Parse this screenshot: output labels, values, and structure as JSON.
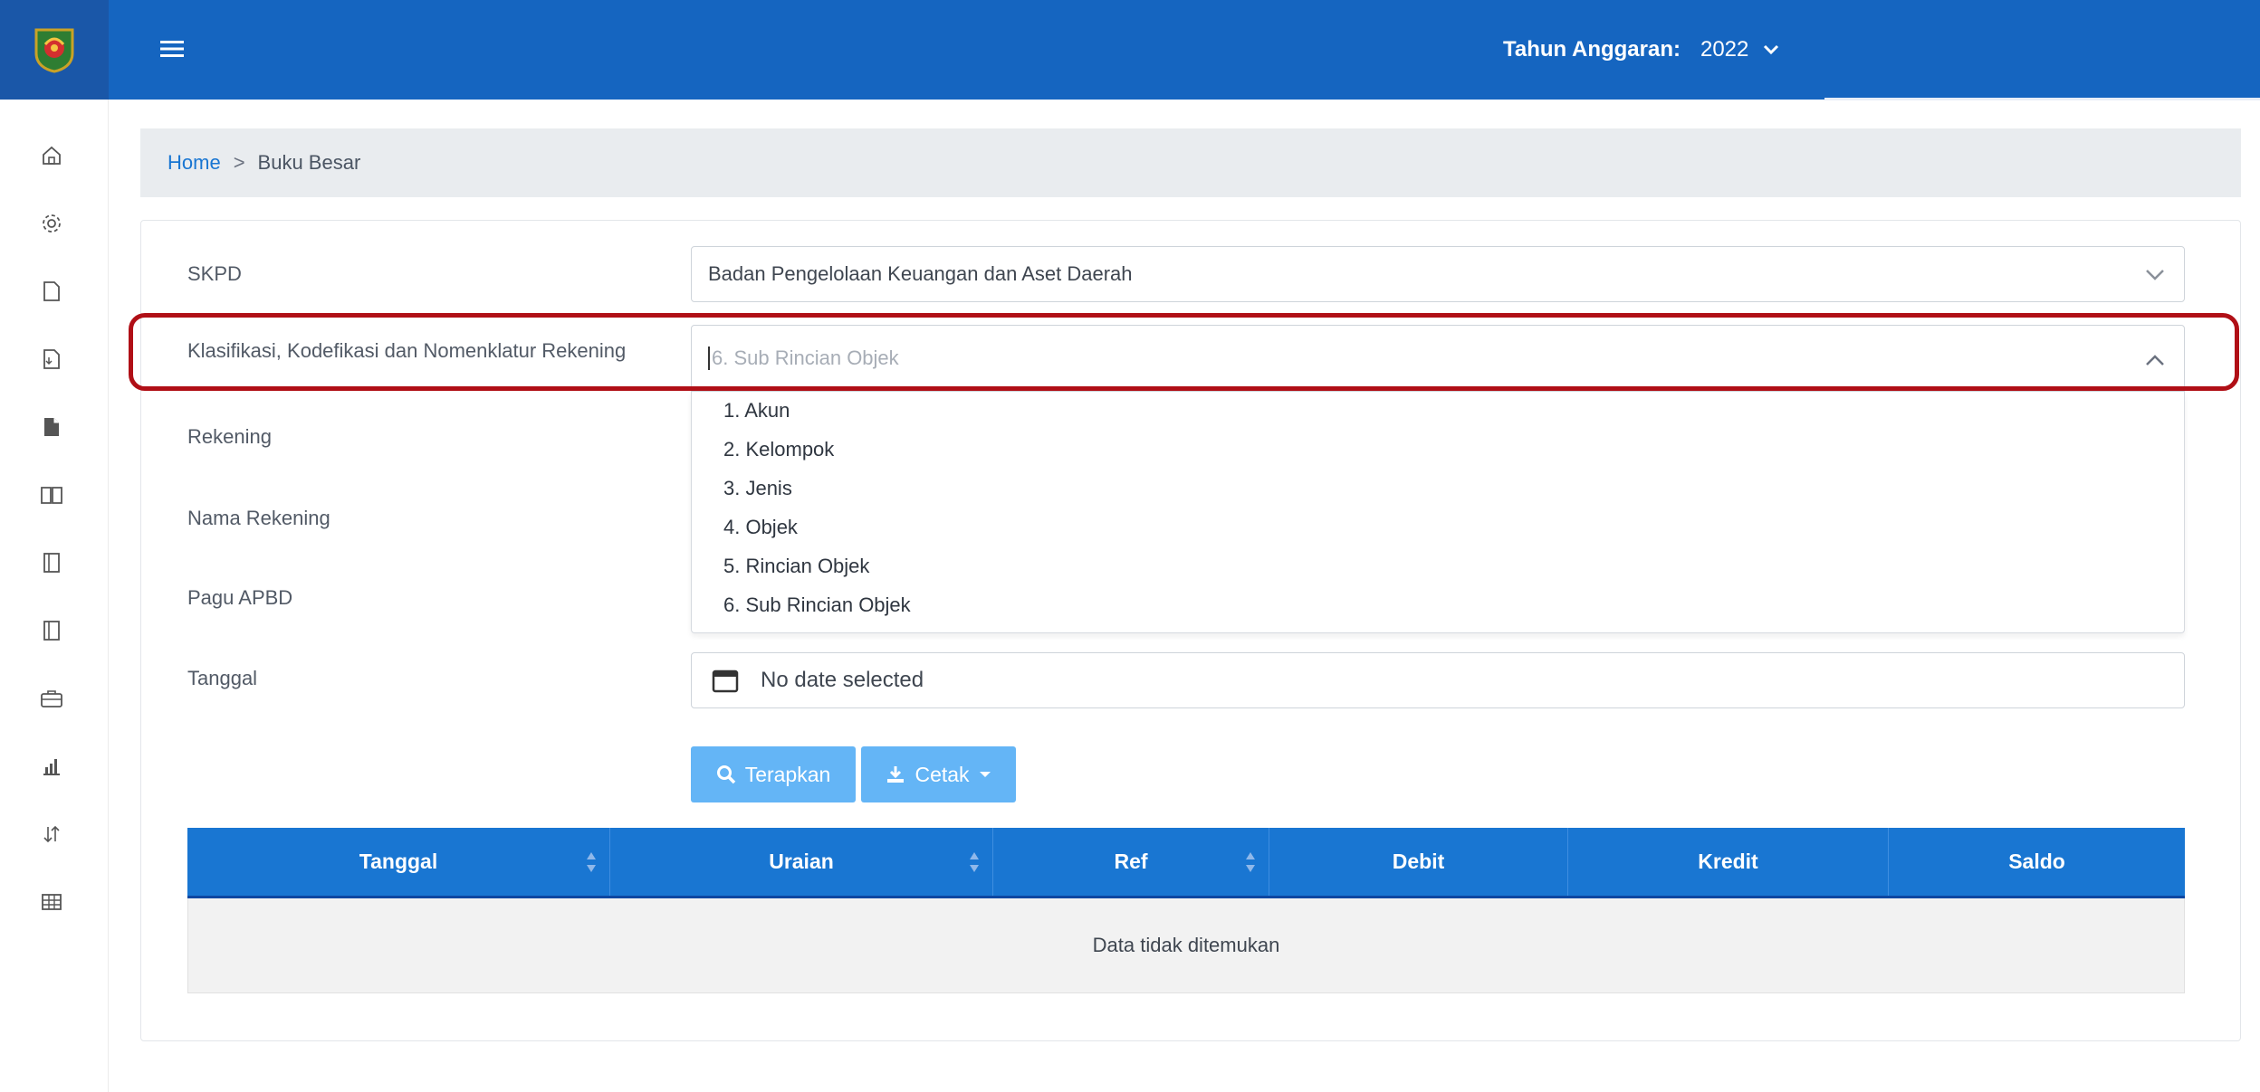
{
  "header": {
    "fiscal_year_label": "Tahun Anggaran:",
    "fiscal_year_value": "2022"
  },
  "sidebar": {
    "icons": [
      "home-icon",
      "gear-icon",
      "file-icon",
      "file-export-icon",
      "file-filled-icon",
      "book-open-icon",
      "notebook-icon",
      "notebook-alt-icon",
      "briefcase-icon",
      "bar-chart-icon",
      "sort-arrows-icon",
      "table-icon"
    ]
  },
  "breadcrumb": {
    "home": "Home",
    "separator": ">",
    "current": "Buku Besar"
  },
  "form": {
    "skpd_label": "SKPD",
    "skpd_value": "Badan Pengelolaan Keuangan dan Aset Daerah",
    "klasifikasi_label": "Klasifikasi, Kodefikasi dan Nomenklatur Rekening",
    "klasifikasi_placeholder": "6. Sub Rincian Objek",
    "klasifikasi_options": [
      "1. Akun",
      "2. Kelompok",
      "3. Jenis",
      "4. Objek",
      "5. Rincian Objek",
      "6. Sub Rincian Objek"
    ],
    "rekening_label": "Rekening",
    "nama_rekening_label": "Nama Rekening",
    "pagu_label": "Pagu APBD",
    "tanggal_label": "Tanggal",
    "tanggal_placeholder": "No date selected"
  },
  "buttons": {
    "apply": "Terapkan",
    "print": "Cetak"
  },
  "table": {
    "columns": [
      "Tanggal",
      "Uraian",
      "Ref",
      "Debit",
      "Kredit",
      "Saldo"
    ],
    "empty_message": "Data tidak ditemukan"
  },
  "colors": {
    "navbar": "#1565c0",
    "accent": "#1976d2",
    "button": "#64b5f6",
    "highlight": "#b00f16"
  }
}
